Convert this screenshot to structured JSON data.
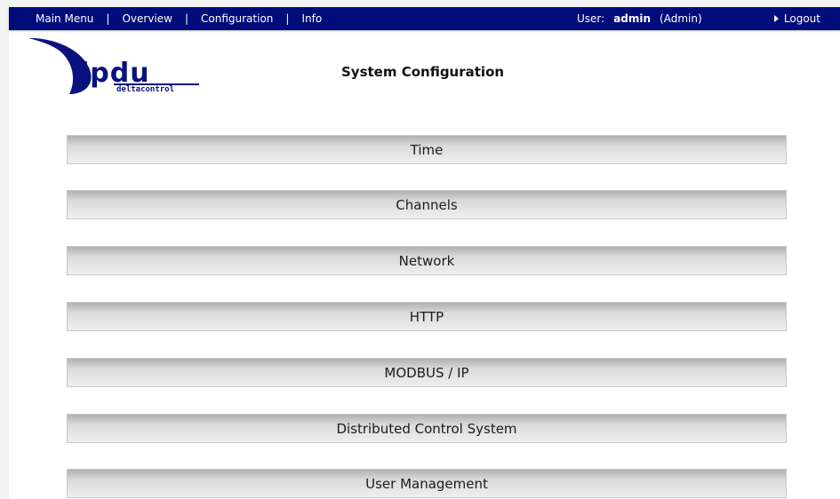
{
  "topbar": {
    "nav": [
      "Main Menu",
      "Overview",
      "Configuration",
      "Info"
    ],
    "separator": "|",
    "user_label": "User:",
    "user_name": "admin",
    "user_role": "(Admin)",
    "logout_label": "Logout"
  },
  "logo": {
    "brand": "ipdu",
    "sub": "deltacontrol"
  },
  "page": {
    "title": "System Configuration"
  },
  "menu": [
    "Time",
    "Channels",
    "Network",
    "HTTP",
    "MODBUS / IP",
    "Distributed Control System",
    "User Management"
  ],
  "colors": {
    "topbar": "#000c7a",
    "logo_blue": "#0a1180"
  }
}
